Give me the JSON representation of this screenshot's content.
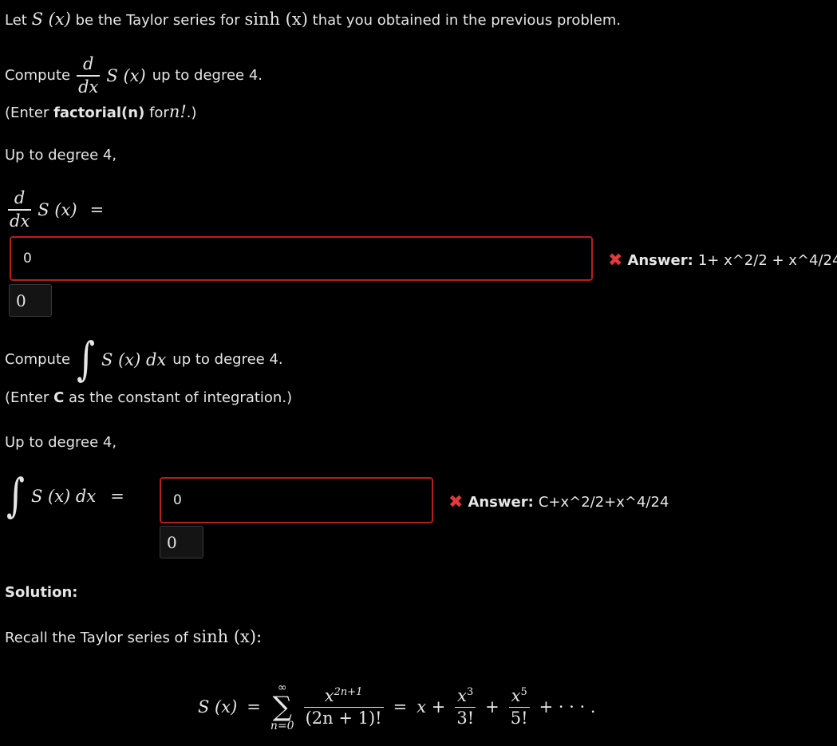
{
  "intro": {
    "lead": "Let",
    "sx": "S (x)",
    "mid": "be the Taylor series for",
    "sinh": "sinh (x)",
    "tail": "that you obtained in the previous problem."
  },
  "part1": {
    "compute": "Compute",
    "d": "d",
    "dx": "dx",
    "sx": "S (x)",
    "upto": "up to degree 4.",
    "hint_open": "(Enter",
    "hint_bold": "factorial(n)",
    "hint_for": "for",
    "hint_math": "n!",
    "hint_close": ".)",
    "upto_line": "Up to degree 4,",
    "eq": "=",
    "input_value": "0",
    "preview": "0",
    "answer_label": "Answer:",
    "answer_value": "1+ x^2/2 + x^4/24"
  },
  "part2": {
    "compute": "Compute",
    "integrand": "S (x) dx",
    "upto": "up to degree 4.",
    "hint_open": "(Enter",
    "hint_bold": "C",
    "hint_close": "as the constant of integration.)",
    "upto_line": "Up to degree 4,",
    "eq": "=",
    "input_value": "0",
    "preview": "0",
    "answer_label": "Answer:",
    "answer_value": "C+x^2/2+x^4/24"
  },
  "solution": {
    "heading": "Solution:",
    "recall": "Recall the Taylor series of",
    "sinh": "sinh (x):",
    "lhs": "S (x)",
    "eq": "=",
    "sum_top": "∞",
    "sum_bot": "n=0",
    "term_num": "x",
    "term_num_exp": "2n+1",
    "term_den": "(2n + 1)!",
    "eq2": "=",
    "x": "x +",
    "t3_num": "x",
    "t3_exp": "3",
    "t3_den": "3!",
    "plus": "+",
    "t5_num": "x",
    "t5_exp": "5",
    "t5_den": "5!",
    "tail": "+ · · · ."
  },
  "colors": {
    "background": "#000000",
    "text": "#e6e6e6",
    "error_border": "#b81e1e",
    "error_mark": "#e03a3a"
  }
}
